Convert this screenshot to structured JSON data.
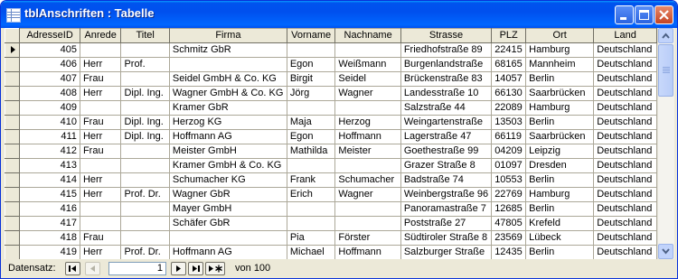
{
  "window": {
    "title": "tblAnschriften : Tabelle"
  },
  "grid": {
    "columns": [
      "AdresseID",
      "Anrede",
      "Titel",
      "Firma",
      "Vorname",
      "Nachname",
      "Strasse",
      "PLZ",
      "Ort",
      "Land"
    ],
    "rows": [
      [
        "405",
        "",
        "",
        "Schmitz GbR",
        "",
        "",
        "Friedhofstraße 89",
        "22415",
        "Hamburg",
        "Deutschland"
      ],
      [
        "406",
        "Herr",
        "Prof.",
        "",
        "Egon",
        "Weißmann",
        "Burgenlandstraße",
        "68165",
        "Mannheim",
        "Deutschland"
      ],
      [
        "407",
        "Frau",
        "",
        "Seidel GmbH & Co. KG",
        "Birgit",
        "Seidel",
        "Brückenstraße 83",
        "14057",
        "Berlin",
        "Deutschland"
      ],
      [
        "408",
        "Herr",
        "Dipl. Ing.",
        "Wagner GmbH & Co. KG",
        "Jörg",
        "Wagner",
        "Landesstraße 10",
        "66130",
        "Saarbrücken",
        "Deutschland"
      ],
      [
        "409",
        "",
        "",
        "Kramer GbR",
        "",
        "",
        "Salzstraße 44",
        "22089",
        "Hamburg",
        "Deutschland"
      ],
      [
        "410",
        "Frau",
        "Dipl. Ing.",
        "Herzog KG",
        "Maja",
        "Herzog",
        "Weingartenstraße",
        "13503",
        "Berlin",
        "Deutschland"
      ],
      [
        "411",
        "Herr",
        "Dipl. Ing.",
        "Hoffmann AG",
        "Egon",
        "Hoffmann",
        "Lagerstraße 47",
        "66119",
        "Saarbrücken",
        "Deutschland"
      ],
      [
        "412",
        "Frau",
        "",
        "Meister GmbH",
        "Mathilda",
        "Meister",
        "Goethestraße 99",
        "04209",
        "Leipzig",
        "Deutschland"
      ],
      [
        "413",
        "",
        "",
        "Kramer GmbH & Co. KG",
        "",
        "",
        "Grazer Straße 8",
        "01097",
        "Dresden",
        "Deutschland"
      ],
      [
        "414",
        "Herr",
        "",
        "Schumacher KG",
        "Frank",
        "Schumacher",
        "Badstraße 74",
        "10553",
        "Berlin",
        "Deutschland"
      ],
      [
        "415",
        "Herr",
        "Prof. Dr.",
        "Wagner GbR",
        "Erich",
        "Wagner",
        "Weinbergstraße 96",
        "22769",
        "Hamburg",
        "Deutschland"
      ],
      [
        "416",
        "",
        "",
        "Mayer GmbH",
        "",
        "",
        "Panoramastraße 7",
        "12685",
        "Berlin",
        "Deutschland"
      ],
      [
        "417",
        "",
        "",
        "Schäfer GbR",
        "",
        "",
        "Poststraße 27",
        "47805",
        "Krefeld",
        "Deutschland"
      ],
      [
        "418",
        "Frau",
        "",
        "",
        "Pia",
        "Förster",
        "Südtiroler Straße 8",
        "23569",
        "Lübeck",
        "Deutschland"
      ],
      [
        "419",
        "Herr",
        "Prof. Dr.",
        "Hoffmann AG",
        "Michael",
        "Hoffmann",
        "Salzburger Straße",
        "12435",
        "Berlin",
        "Deutschland"
      ]
    ]
  },
  "navigator": {
    "label": "Datensatz:",
    "current_record": "1",
    "of_label": "von",
    "total_records": "100",
    "buttons": [
      "first-record-icon",
      "previous-record-icon",
      "next-record-icon",
      "last-record-icon",
      "new-record-icon"
    ]
  },
  "colors": {
    "titlebar": "#0054e3",
    "chrome": "#ece9d8",
    "gridline": "#aca899",
    "close": "#e0502e"
  }
}
